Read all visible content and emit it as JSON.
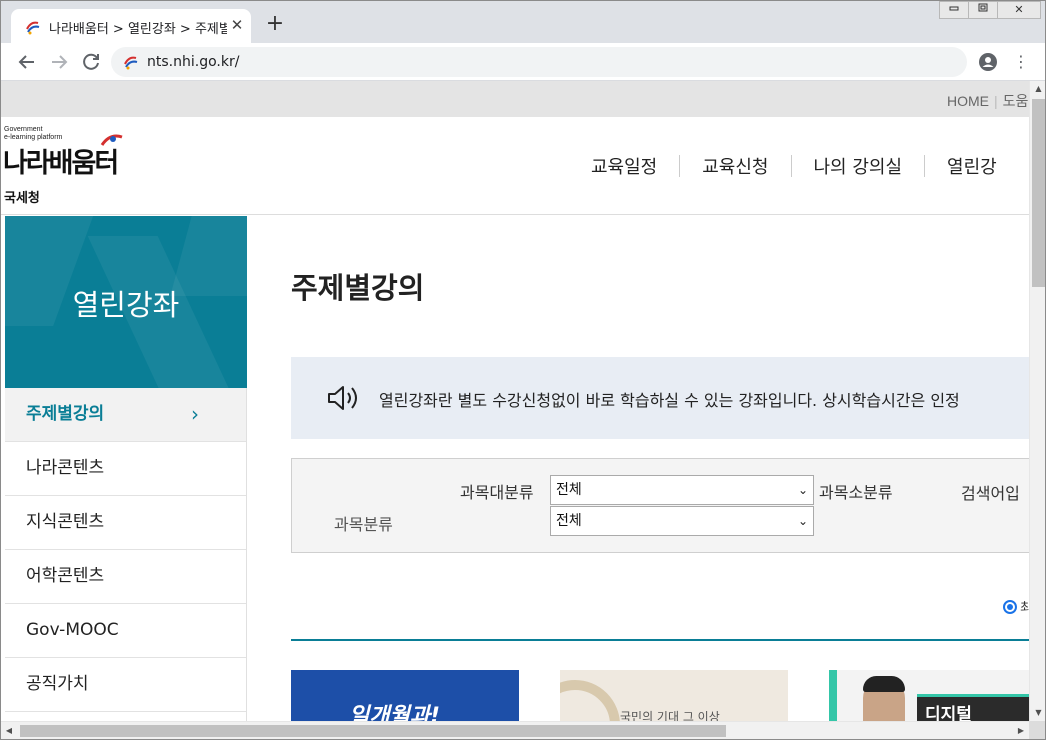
{
  "browser": {
    "tab_title": "나라배움터 > 열린강좌 > 주제별강의",
    "tab_close": "✕",
    "new_tab": "+",
    "url": "nts.nhi.go.kr/",
    "window_controls": {
      "minimize": "▭",
      "restore": "⧉",
      "close": "✕"
    },
    "icons": [
      "back-icon",
      "forward-icon",
      "reload-icon",
      "profile-icon",
      "kebab-menu-icon"
    ]
  },
  "utility": {
    "home": "HOME",
    "help": "도움"
  },
  "logo": {
    "sub_line1": "Government",
    "sub_line2": "e-learning platform",
    "main": "나라배움터",
    "agency": "국세청"
  },
  "gnb": {
    "items": [
      "교육일정",
      "교육신청",
      "나의 강의실",
      "열린강"
    ]
  },
  "lnb": {
    "title": "열린강좌",
    "items": [
      {
        "label": "주제별강의",
        "active": true,
        "arrow": "›"
      },
      {
        "label": "나라콘텐츠"
      },
      {
        "label": "지식콘텐츠"
      },
      {
        "label": "어학콘텐츠"
      },
      {
        "label": "Gov-MOOC"
      },
      {
        "label": "공직가치"
      }
    ]
  },
  "main": {
    "title": "주제별강의",
    "notice": "열린강좌란 별도 수강신청없이 바로 학습하실 수 있는 강좌입니다. 상시학습시간은 인정",
    "search": {
      "category_label": "과목분류",
      "major_label": "과목대분류",
      "major_value": "전체",
      "minor_value": "전체",
      "minor_label": "과목소분류",
      "keyword_label": "검색어입"
    },
    "radio_label": "최",
    "cards": [
      {
        "text": "일개월과!"
      },
      {
        "text": "국민의 기대 그 이상"
      },
      {
        "text": "디지털"
      }
    ]
  },
  "colors": {
    "accent": "#0a7e96",
    "notice_bg": "#e8edf4",
    "search_bg": "#f4f4f4"
  }
}
